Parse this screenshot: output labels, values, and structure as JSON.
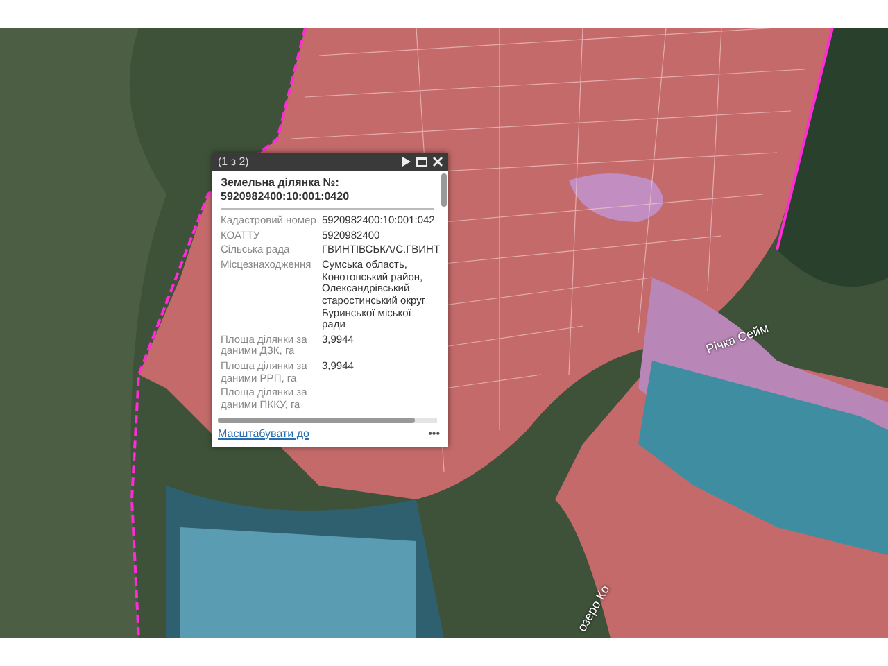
{
  "popup": {
    "counter": "(1 з 2)",
    "title": "Земельна ділянка №: 5920982400:10:001:0420",
    "fields": [
      {
        "label": "Кадастровий номер",
        "value": "5920982400:10:001:042"
      },
      {
        "label": "КОАТТУ",
        "value": "5920982400"
      },
      {
        "label": "Сільська рада",
        "value": "ГВИНТІВСЬКА/С.ГВИНТ"
      },
      {
        "label": "Місцезнаходження",
        "value": "Сумська область, Конотопський район, Олександрівський старостинський округ Буринської міської ради"
      },
      {
        "label": "Площа ділянки за даними ДЗК, га",
        "value": "3,9944"
      },
      {
        "label": "Площа ділянки за даними РРП, га",
        "value": "3,9944"
      },
      {
        "label": "Площа ділянки за даними ПККУ, га"
      }
    ],
    "zoom_link": "Масштабувати до",
    "more": "•••"
  },
  "map_labels": [
    {
      "text": "Річка Сейм"
    },
    {
      "text": "озеро Ко"
    }
  ]
}
